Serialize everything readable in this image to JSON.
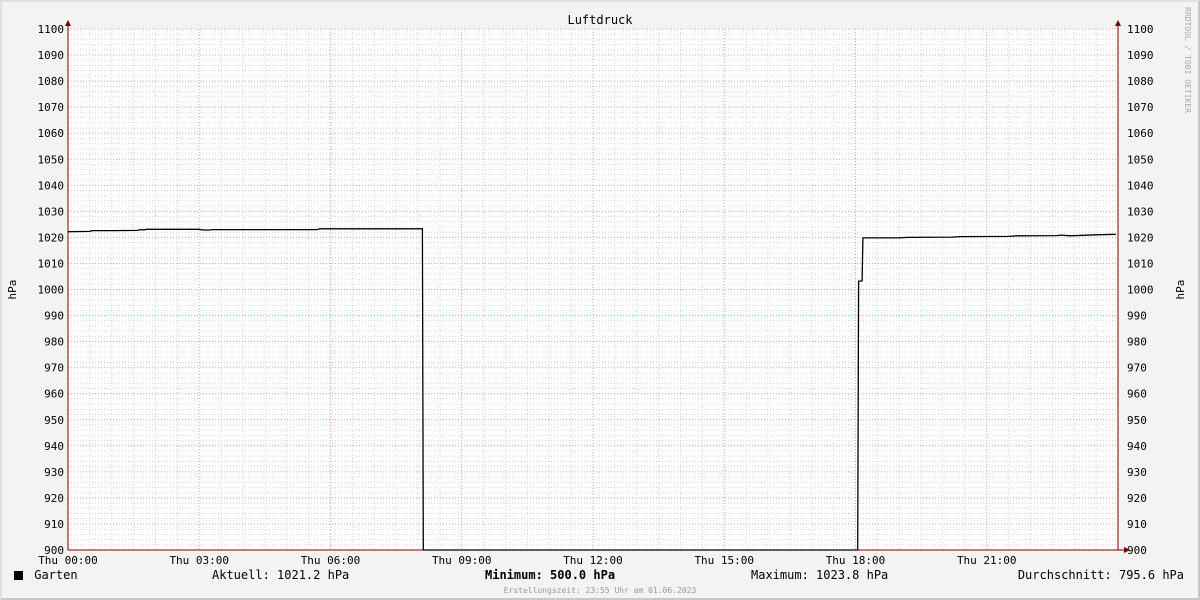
{
  "colors": {
    "background": "#f3f3f3",
    "canvas": "#ffffff",
    "major_grid": "#e8a0a0",
    "minor_grid": "#d8d8d8",
    "series": "#000000",
    "axis": "#7a0000"
  },
  "chart_data": {
    "type": "line",
    "title": "Luftdruck",
    "ylabel": "hPa",
    "ylabel_right": "hPa",
    "ylim": [
      900,
      1100
    ],
    "y_ticks": [
      900,
      910,
      920,
      930,
      940,
      950,
      960,
      970,
      980,
      990,
      1000,
      1010,
      1020,
      1030,
      1040,
      1050,
      1060,
      1070,
      1080,
      1090,
      1100
    ],
    "xlim": [
      "Thu 00:00",
      "Thu 23:55"
    ],
    "x_ticks": [
      "Thu 00:00",
      "Thu 03:00",
      "Thu 06:00",
      "Thu 09:00",
      "Thu 12:00",
      "Thu 15:00",
      "Thu 18:00",
      "Thu 21:00"
    ],
    "x_tick_hours": [
      0,
      3,
      6,
      9,
      12,
      15,
      18,
      21
    ],
    "x_max_hours": 24,
    "grid": true,
    "series": [
      {
        "name": "Garten",
        "color": "#000000",
        "points": [
          [
            0.0,
            1022.2
          ],
          [
            0.5,
            1022.3
          ],
          [
            0.55,
            1022.6
          ],
          [
            1.0,
            1022.6
          ],
          [
            1.6,
            1022.7
          ],
          [
            1.65,
            1023.0
          ],
          [
            1.75,
            1022.9
          ],
          [
            1.8,
            1023.1
          ],
          [
            3.0,
            1023.1
          ],
          [
            3.05,
            1022.9
          ],
          [
            3.2,
            1022.8
          ],
          [
            3.3,
            1023.0
          ],
          [
            5.7,
            1023.0
          ],
          [
            5.75,
            1023.3
          ],
          [
            8.1,
            1023.3
          ],
          [
            8.12,
            900
          ],
          [
            18.05,
            900
          ],
          [
            18.07,
            1003.2
          ],
          [
            18.15,
            1003.3
          ],
          [
            18.17,
            1019.8
          ],
          [
            19.0,
            1019.8
          ],
          [
            19.2,
            1020.0
          ],
          [
            20.2,
            1020.1
          ],
          [
            20.4,
            1020.3
          ],
          [
            21.5,
            1020.4
          ],
          [
            21.7,
            1020.6
          ],
          [
            22.6,
            1020.7
          ],
          [
            22.7,
            1020.9
          ],
          [
            22.9,
            1020.6
          ],
          [
            23.2,
            1020.8
          ],
          [
            23.5,
            1021.0
          ],
          [
            23.95,
            1021.2
          ]
        ]
      }
    ]
  },
  "legend": {
    "series_name": "Garten",
    "current": "Aktuell: 1021.2 hPa",
    "minimum_label": "Minimum:",
    "minimum_value": " 500.0 hPa",
    "maximum": "Maximum: 1023.8 hPa",
    "average": "Durchschnitt: 795.6 hPa"
  },
  "footer": "Erstellungszeit: 23:55 Uhr am 01.06.2023",
  "watermark": "RRDTOOL / TOBI OETIKER"
}
